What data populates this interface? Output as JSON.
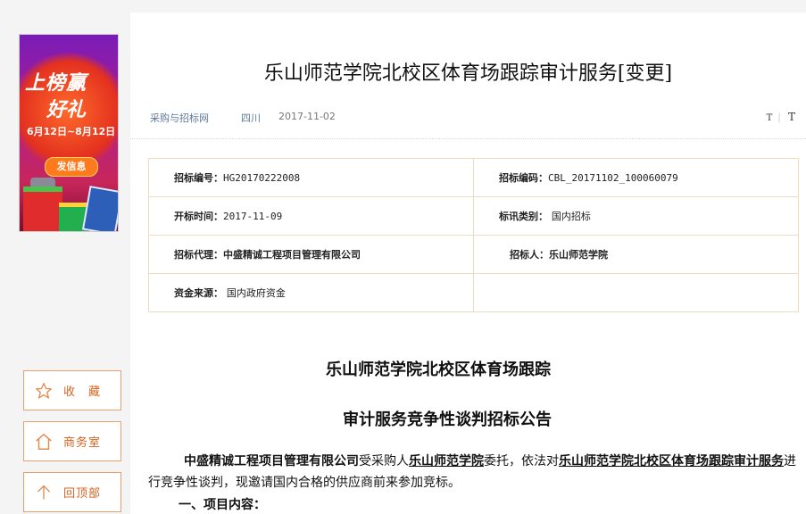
{
  "sidebar": {
    "banner": {
      "line1": "上榜赢",
      "line2": "好礼",
      "dates": "6月12日~8月12日",
      "button": "发信息"
    },
    "buttons": [
      {
        "label": "收　藏",
        "icon": "star-icon"
      },
      {
        "label": "商务室",
        "icon": "home-icon"
      },
      {
        "label": "回顶部",
        "icon": "arrow-up-icon"
      }
    ]
  },
  "article": {
    "title": "乐山师范学院北校区体育场跟踪审计服务[变更]",
    "meta": {
      "source": "采购与招标网",
      "region": "四川",
      "date": "2017-11-02"
    },
    "fontsize": {
      "small": "T",
      "large": "T"
    },
    "info": {
      "bid_number_label": "招标编号：",
      "bid_number": "HG20170222008",
      "bid_code_label": "招标编码：",
      "bid_code": "CBL_20171102_100060079",
      "open_time_label": "开标时间：",
      "open_time": "2017-11-09",
      "category_label": "标讯类别：",
      "category": "国内招标",
      "agent_label": "招标代理：",
      "agent": "中盛精诚工程项目管理有限公司",
      "tenderer_label": "招标人：",
      "tenderer": "乐山师范学院",
      "funding_label": "资金来源：",
      "funding": "国内政府资金"
    },
    "heading1": "乐山师范学院北校区体育场跟踪",
    "heading2": "审计服务竞争性谈判招标公告",
    "body": {
      "agent": "中盛精诚工程项目管理有限公司",
      "text1": "受采购人",
      "purchaser": "乐山师范学院",
      "text2": "委托，依法对",
      "project": "乐山师范学院北校区体育场跟踪审计服务",
      "text3": "进行竞争性谈判，现邀请国内合格的供应商前来参加竞标。"
    },
    "section1": "一、项目内容："
  }
}
